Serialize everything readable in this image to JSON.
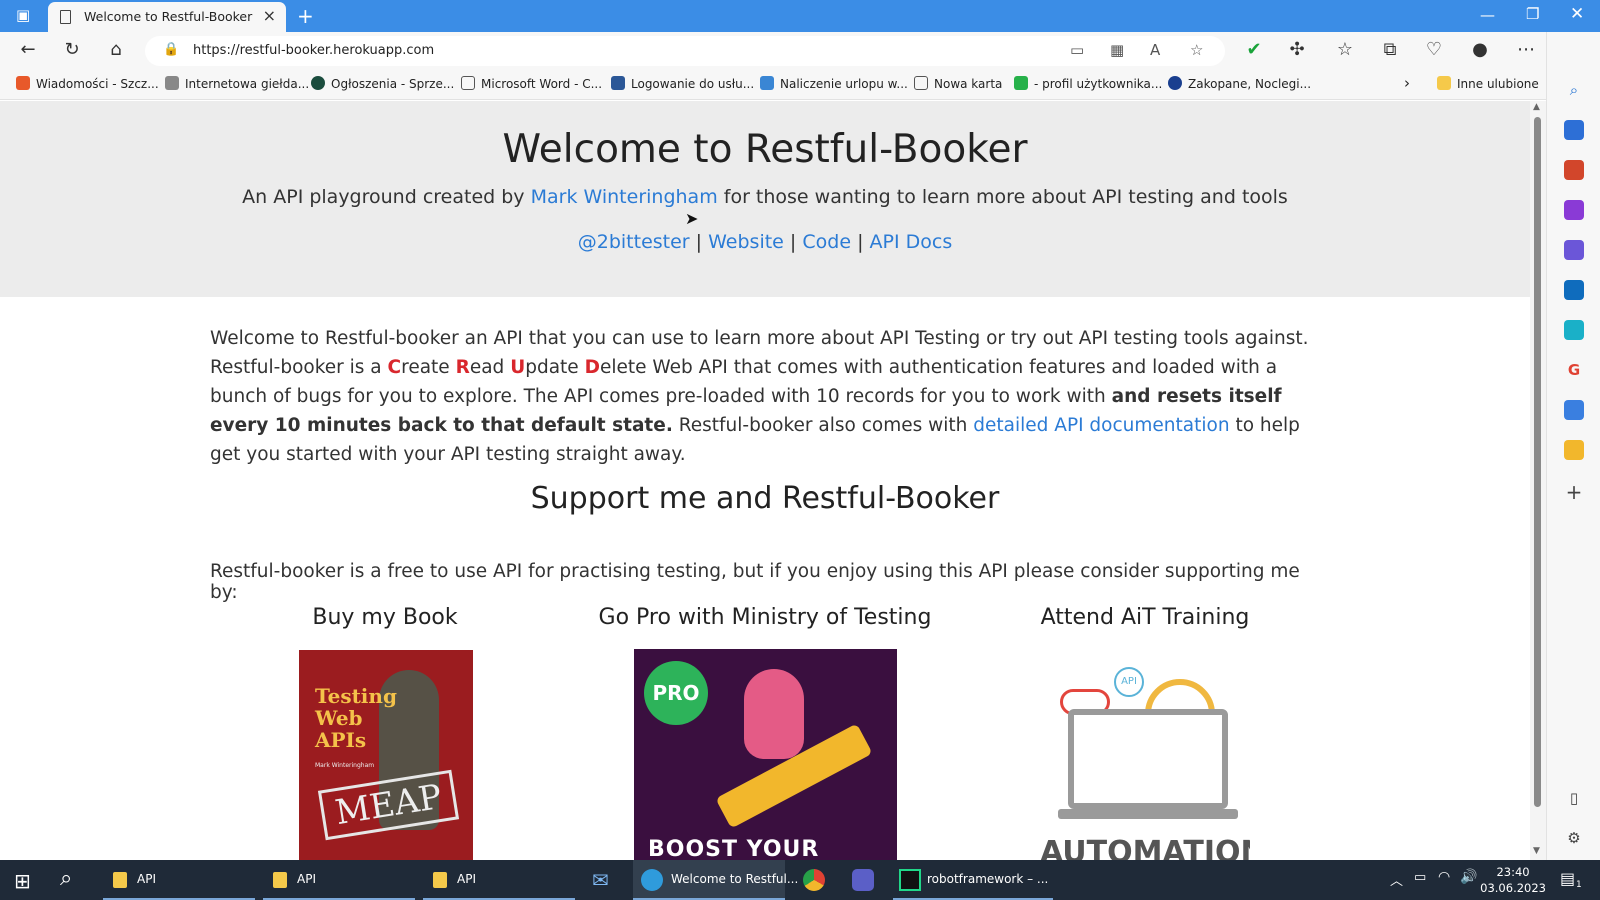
{
  "browser": {
    "tab_title": "Welcome to Restful-Booker",
    "url": "https://restful-booker.herokuapp.com"
  },
  "bookmarks": [
    {
      "label": "Wiadomości - Szcz...",
      "color": "#e8592a"
    },
    {
      "label": "Internetowa giełda...",
      "color": "#888888"
    },
    {
      "label": "Ogłoszenia - Sprze...",
      "color": "#1b4d3e"
    },
    {
      "label": "Microsoft Word - C...",
      "color": "#ffffff"
    },
    {
      "label": "Logowanie do usłu...",
      "color": "#2b5797"
    },
    {
      "label": "Naliczenie urlopu w...",
      "color": "#3a86d4"
    },
    {
      "label": "Nowa karta",
      "color": "#ffffff"
    },
    {
      "label": "- profil użytkownika...",
      "color": "#27b14a"
    },
    {
      "label": "Zakopane, Noclegi...",
      "color": "#1a3f8f"
    }
  ],
  "bookmarks_other": "Inne ulubione",
  "hero": {
    "title": "Welcome to Restful-Booker",
    "subtitle_before": "An API playground created by",
    "author": "Mark Winteringham",
    "subtitle_after": "for those wanting to learn more about API testing and tools",
    "links": [
      "@2bittester",
      "Website",
      "Code",
      "API Docs"
    ],
    "separator": "|"
  },
  "intro": {
    "p1": "Welcome to Restful-booker an API that you can use to learn more about API Testing or try out API testing tools against. Restful-booker is a",
    "crud": [
      [
        "C",
        "reate"
      ],
      [
        "R",
        "ead"
      ],
      [
        "U",
        "pdate"
      ],
      [
        "D",
        "elete"
      ]
    ],
    "p2": "Web API that comes with authentication features and loaded with a bunch of bugs for you to explore. The API comes pre-loaded with 10 records for you to work with",
    "bold": "and resets itself every 10 minutes back to that default state.",
    "p3": "Restful-booker also comes with",
    "doc_link": "detailed API documentation",
    "p4": "to help get you started with your API testing straight away."
  },
  "support": {
    "title": "Support me and Restful-Booker",
    "text": "Restful-booker is a free to use API for practising testing, but if you enjoy using this API please consider supporting me by:",
    "columns": [
      "Buy my Book",
      "Go Pro with Ministry of Testing",
      "Attend AiT Training"
    ]
  },
  "images": {
    "book_title": "Testing Web APIs",
    "book_author": "Mark Winteringham",
    "book_stamp": "MEAP",
    "pro_badge": "PRO",
    "pro_banner": "BOOST YOUR LEARNING!",
    "ait_badge": "API",
    "ait_word": "AUTOMATION"
  },
  "taskbar": {
    "items": [
      "API",
      "API",
      "API",
      "Welcome to Restful...",
      "robotframework – ..."
    ],
    "time": "23:40",
    "date": "03.06.2023",
    "notification_count": "1"
  },
  "colors": {
    "link": "#2b7bd5",
    "crud_red": "#d9272d",
    "titlebar": "#3b8de6"
  }
}
